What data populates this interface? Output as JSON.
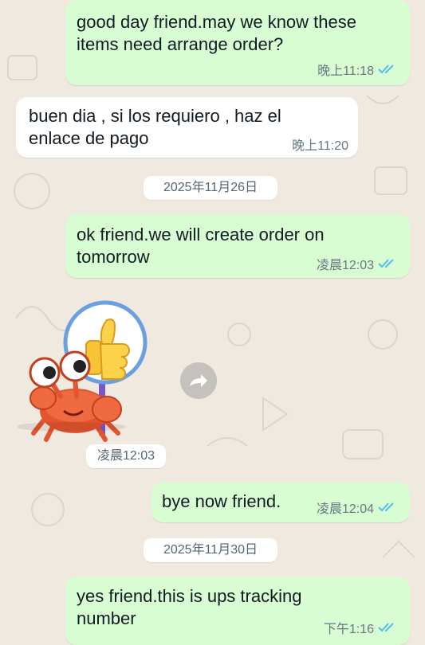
{
  "colors": {
    "chat_background": "#efe9e0",
    "outgoing_bubble": "#d9fdd3",
    "incoming_bubble": "#ffffff",
    "read_ticks": "#53bdeb"
  },
  "messages": [
    {
      "direction": "outgoing",
      "text": "good day friend.may we know these\nitems need arrange order?",
      "time": "晚上11:18",
      "status": "read"
    },
    {
      "direction": "incoming",
      "text": "buen dia , si los requiero , haz el\nenlace de pago",
      "time": "晚上11:20"
    },
    {
      "direction": "outgoing",
      "text": "ok friend.we will create order on\ntomorrow",
      "time": "凌晨12:03",
      "status": "read"
    },
    {
      "direction": "incoming",
      "type": "sticker",
      "sticker": "crab-thumbs-up-sticker",
      "time": "凌晨12:03"
    },
    {
      "direction": "outgoing",
      "text": "bye now friend.",
      "time": "凌晨12:04",
      "status": "read"
    },
    {
      "direction": "outgoing",
      "text": "yes friend.this is ups tracking\nnumber",
      "time": "下午1:16",
      "status": "read"
    }
  ],
  "dates": [
    "2025年11月26日",
    "2025年11月30日"
  ],
  "icons": {
    "forward": "forward-arrow-icon",
    "read_receipt": "double-check-icon"
  }
}
